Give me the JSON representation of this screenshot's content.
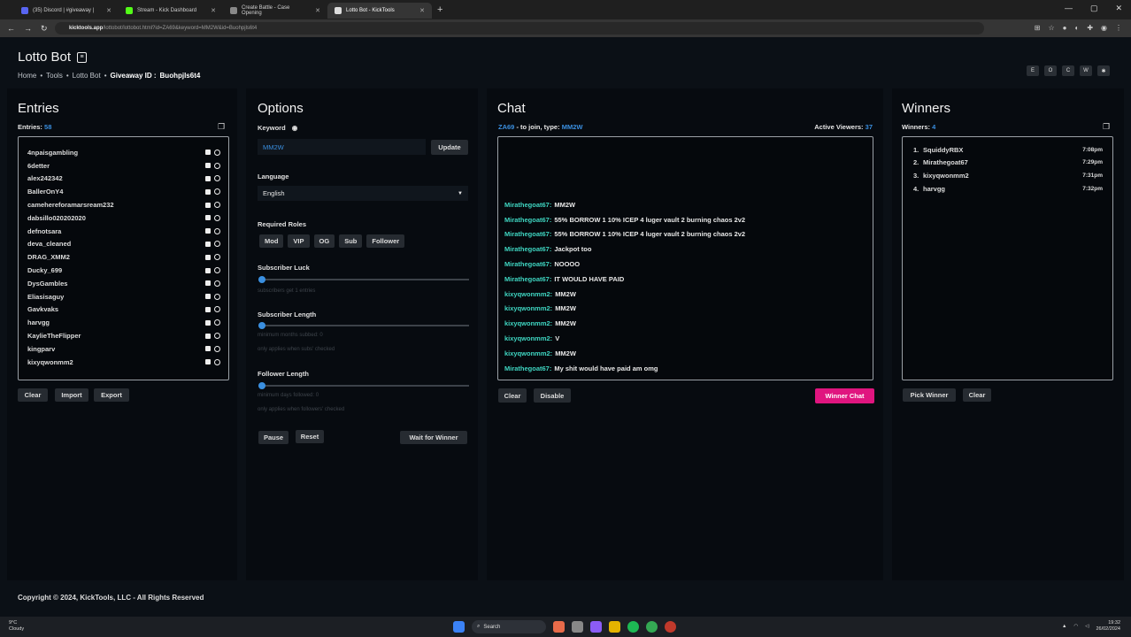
{
  "browser": {
    "tabs": [
      {
        "title": "(35) Discord | #giveaway |",
        "active": false
      },
      {
        "title": "Stream - Kick Dashboard",
        "active": false
      },
      {
        "title": "Create Battle - Case Opening",
        "active": false
      },
      {
        "title": "Lotto Bot - KickTools",
        "active": true
      }
    ],
    "url_host": "kicktools.app",
    "url_path": "/lottobot/lottobot.html?id=ZA69&keyword=MM2W&id=Buohpjls6t4"
  },
  "header": {
    "title": "Lotto Bot",
    "breadcrumb": [
      "Home",
      "Tools",
      "Lotto Bot"
    ],
    "giveaway_label": "Giveaway ID :",
    "giveaway_id": "Buohpjls6t4",
    "top_icons": [
      "E",
      "O",
      "C",
      "W",
      "✱"
    ]
  },
  "entries": {
    "title": "Entries",
    "count_label": "Entries:",
    "count": "58",
    "list": [
      "4npaisgambling",
      "6detter",
      "alex242342",
      "BallerOnY4",
      "camehereforamarsream232",
      "dabsillo020202020",
      "defnotsara",
      "deva_cleaned",
      "DRAG_XMM2",
      "Ducky_699",
      "DysGambles",
      "Eliasisaguy",
      "Gavkvaks",
      "harvgg",
      "KaylieTheFlipper",
      "kingparv",
      "kixyqwonmm2"
    ],
    "buttons": [
      "Clear",
      "Import",
      "Export"
    ]
  },
  "options": {
    "title": "Options",
    "keyword_label": "Keyword",
    "keyword_value": "MM2W",
    "update": "Update",
    "language_label": "Language",
    "language_value": "English",
    "roles_label": "Required Roles",
    "roles": [
      "Mod",
      "VIP",
      "OG",
      "Sub",
      "Follower"
    ],
    "sub_luck_label": "Subscriber Luck",
    "sub_luck_hint": "subscribers get 1 entries",
    "sub_luck_value": 0,
    "sub_length_label": "Subscriber Length",
    "sub_length_hint1": "minimum months subbed: 0",
    "sub_length_hint2": "only applies when subs' checked",
    "sub_length_value": 0,
    "follow_label": "Follower Length",
    "follow_hint1": "minimum days followed: 0",
    "follow_hint2": "only applies when followers' checked",
    "follow_value": 0,
    "pause": "Pause",
    "reset": "Reset",
    "wait": "Wait for Winner"
  },
  "chat": {
    "title": "Chat",
    "channel": "ZA69",
    "join_text": "- to join, type:",
    "keyword": "MM2W",
    "viewers_label": "Active Viewers:",
    "viewers": "37",
    "messages": [
      {
        "user": "Mirathegoat67:",
        "text": "MM2W"
      },
      {
        "user": "Mirathegoat67:",
        "text": "55% BORROW 1 10% ICEP 4 luger vault 2 burning chaos 2v2"
      },
      {
        "user": "Mirathegoat67:",
        "text": "55% BORROW 1 10% ICEP 4 luger vault 2 burning chaos 2v2"
      },
      {
        "user": "Mirathegoat67:",
        "text": "Jackpot too"
      },
      {
        "user": "Mirathegoat67:",
        "text": "NOOOO"
      },
      {
        "user": "Mirathegoat67:",
        "text": "IT WOULD HAVE PAID"
      },
      {
        "user": "kixyqwonmm2:",
        "text": "MM2W"
      },
      {
        "user": "kixyqwonmm2:",
        "text": "MM2W"
      },
      {
        "user": "kixyqwonmm2:",
        "text": "MM2W"
      },
      {
        "user": "kixyqwonmm2:",
        "text": "V"
      },
      {
        "user": "kixyqwonmm2:",
        "text": "MM2W"
      },
      {
        "user": "Mirathegoat67:",
        "text": "My shit would have paid am omg"
      }
    ],
    "clear": "Clear",
    "disable": "Disable",
    "winner_chat": "Winner Chat"
  },
  "winners": {
    "title": "Winners",
    "count_label": "Winners:",
    "count": "4",
    "list": [
      {
        "n": "1.",
        "name": "SquiddyRBX",
        "time": "7:08pm"
      },
      {
        "n": "2.",
        "name": "Mirathegoat67",
        "time": "7:29pm"
      },
      {
        "n": "3.",
        "name": "kixyqwonmm2",
        "time": "7:31pm"
      },
      {
        "n": "4.",
        "name": "harvgg",
        "time": "7:32pm"
      }
    ],
    "pick": "Pick Winner",
    "clear": "Clear"
  },
  "footer": "Copyright © 2024, KickTools, LLC - All Rights Reserved",
  "taskbar": {
    "weather_temp": "9°C",
    "weather_desc": "Cloudy",
    "search": "Search",
    "time": "19:32",
    "date": "26/02/2024"
  }
}
